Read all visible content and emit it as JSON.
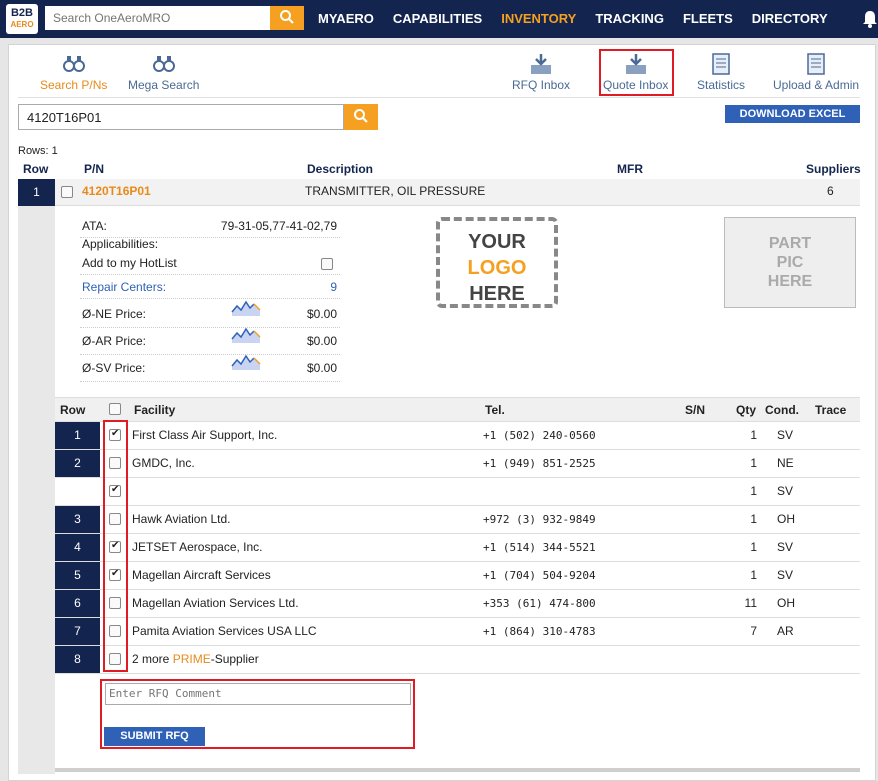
{
  "topbar": {
    "logo_top": "B2B",
    "logo_bottom": "AERO",
    "search_placeholder": "Search OneAeroMRO",
    "nav": [
      "MYAERO",
      "CAPABILITIES",
      "INVENTORY",
      "TRACKING",
      "FLEETS",
      "DIRECTORY"
    ],
    "active_nav": "INVENTORY"
  },
  "toolbar": {
    "search_pns": "Search P/Ns",
    "mega_search": "Mega Search",
    "rfq_inbox": "RFQ Inbox",
    "quote_inbox": "Quote Inbox",
    "statistics": "Statistics",
    "upload_admin": "Upload & Admin"
  },
  "search": {
    "value": "4120T16P01",
    "download_label": "DOWNLOAD EXCEL"
  },
  "results": {
    "rows_label": "Rows: 1",
    "headers": {
      "row": "Row",
      "pn": "P/N",
      "description": "Description",
      "mfr": "MFR",
      "suppliers": "Suppliers"
    },
    "part": {
      "row": "1",
      "pn": "4120T16P01",
      "description": "TRANSMITTER, OIL PRESSURE",
      "mfr": "",
      "suppliers": "6"
    }
  },
  "details": {
    "ata_label": "ATA:",
    "ata_value": "79-31-05,77-41-02,79",
    "applicabilities_label": "Applicabilities:",
    "hotlist_label": "Add to my HotList",
    "repair_label": "Repair Centers:",
    "repair_value": "9",
    "ne_label": "Ø-NE Price:",
    "ne_value": "$0.00",
    "ar_label": "Ø-AR Price:",
    "ar_value": "$0.00",
    "sv_label": "Ø-SV Price:",
    "sv_value": "$0.00",
    "logo_line1": "YOUR",
    "logo_line2": "LOGO",
    "logo_line3": "HERE",
    "partpic_line1": "PART",
    "partpic_line2": "PIC",
    "partpic_line3": "HERE"
  },
  "suppliers": {
    "headers": {
      "row": "Row",
      "facility": "Facility",
      "tel": "Tel.",
      "sn": "S/N",
      "qty": "Qty",
      "cond": "Cond.",
      "trace": "Trace"
    },
    "rows": [
      {
        "row": "1",
        "checked": true,
        "facility": "First Class Air Support, Inc.",
        "tel": "+1 (502) 240-0560",
        "qty": "1",
        "cond": "SV"
      },
      {
        "row": "2",
        "checked": false,
        "facility": "GMDC, Inc.",
        "tel": "+1 (949) 851-2525",
        "qty": "1",
        "cond": "NE"
      },
      {
        "row": "",
        "checked": true,
        "facility": "",
        "tel": "",
        "qty": "1",
        "cond": "SV"
      },
      {
        "row": "3",
        "checked": false,
        "facility": "Hawk Aviation Ltd.",
        "tel": "+972 (3) 932-9849",
        "qty": "1",
        "cond": "OH"
      },
      {
        "row": "4",
        "checked": true,
        "facility": "JETSET Aerospace, Inc.",
        "tel": "+1 (514) 344-5521",
        "qty": "1",
        "cond": "SV"
      },
      {
        "row": "5",
        "checked": true,
        "facility": "Magellan Aircraft Services",
        "tel": "+1 (704) 504-9204",
        "qty": "1",
        "cond": "SV"
      },
      {
        "row": "6",
        "checked": false,
        "facility": "Magellan Aviation Services Ltd.",
        "tel": "+353 (61) 474-800",
        "qty": "11",
        "cond": "OH"
      },
      {
        "row": "7",
        "checked": false,
        "facility": "Pamita Aviation Services USA LLC",
        "tel": "+1 (864) 310-4783",
        "qty": "7",
        "cond": "AR"
      }
    ],
    "more_row": "8",
    "more_prefix": "2 more ",
    "more_prime": "PRIME",
    "more_suffix": "-Supplier",
    "comment_placeholder": "Enter RFQ Comment",
    "submit_label": "SUBMIT RFQ"
  },
  "colors": {
    "navy": "#13244e",
    "orange": "#f5a020",
    "blue": "#2f62b6",
    "highlight": "#e01b24"
  }
}
